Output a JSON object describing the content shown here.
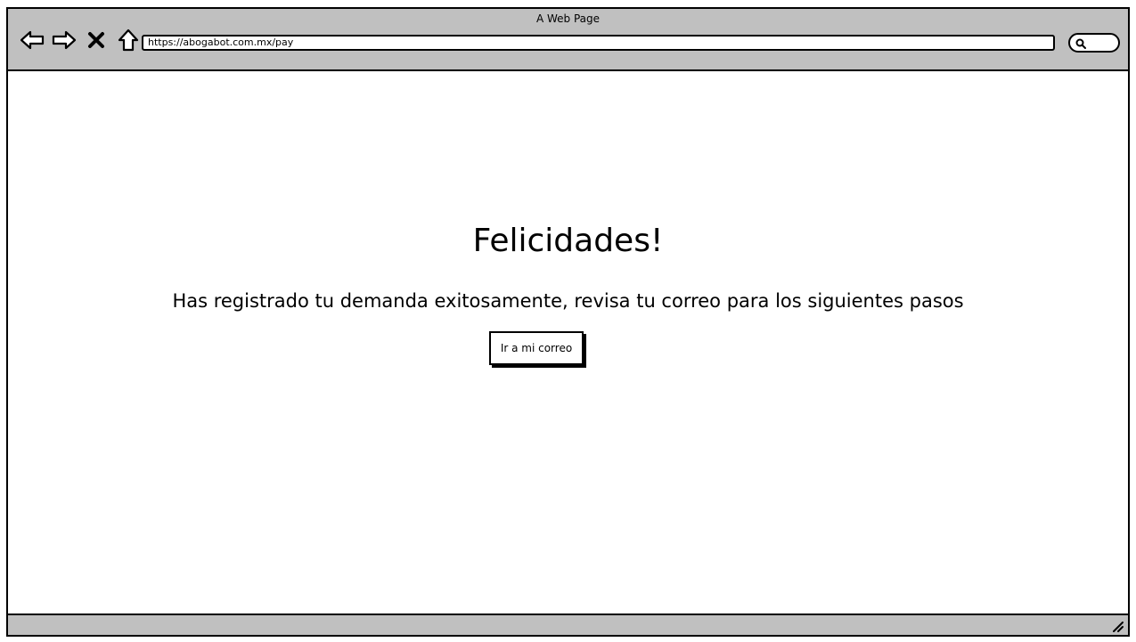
{
  "window": {
    "title": "A Web Page"
  },
  "browser": {
    "url": "https://abogabot.com.mx/pay",
    "icons": [
      "back-icon",
      "forward-icon",
      "close-icon",
      "home-icon",
      "search-icon",
      "resize-grip-icon"
    ]
  },
  "main": {
    "heading": "Felicidades!",
    "message": "Has registrado tu demanda exitosamente, revisa tu correo para los siguientes pasos",
    "button_label": "Ir a mi correo"
  }
}
